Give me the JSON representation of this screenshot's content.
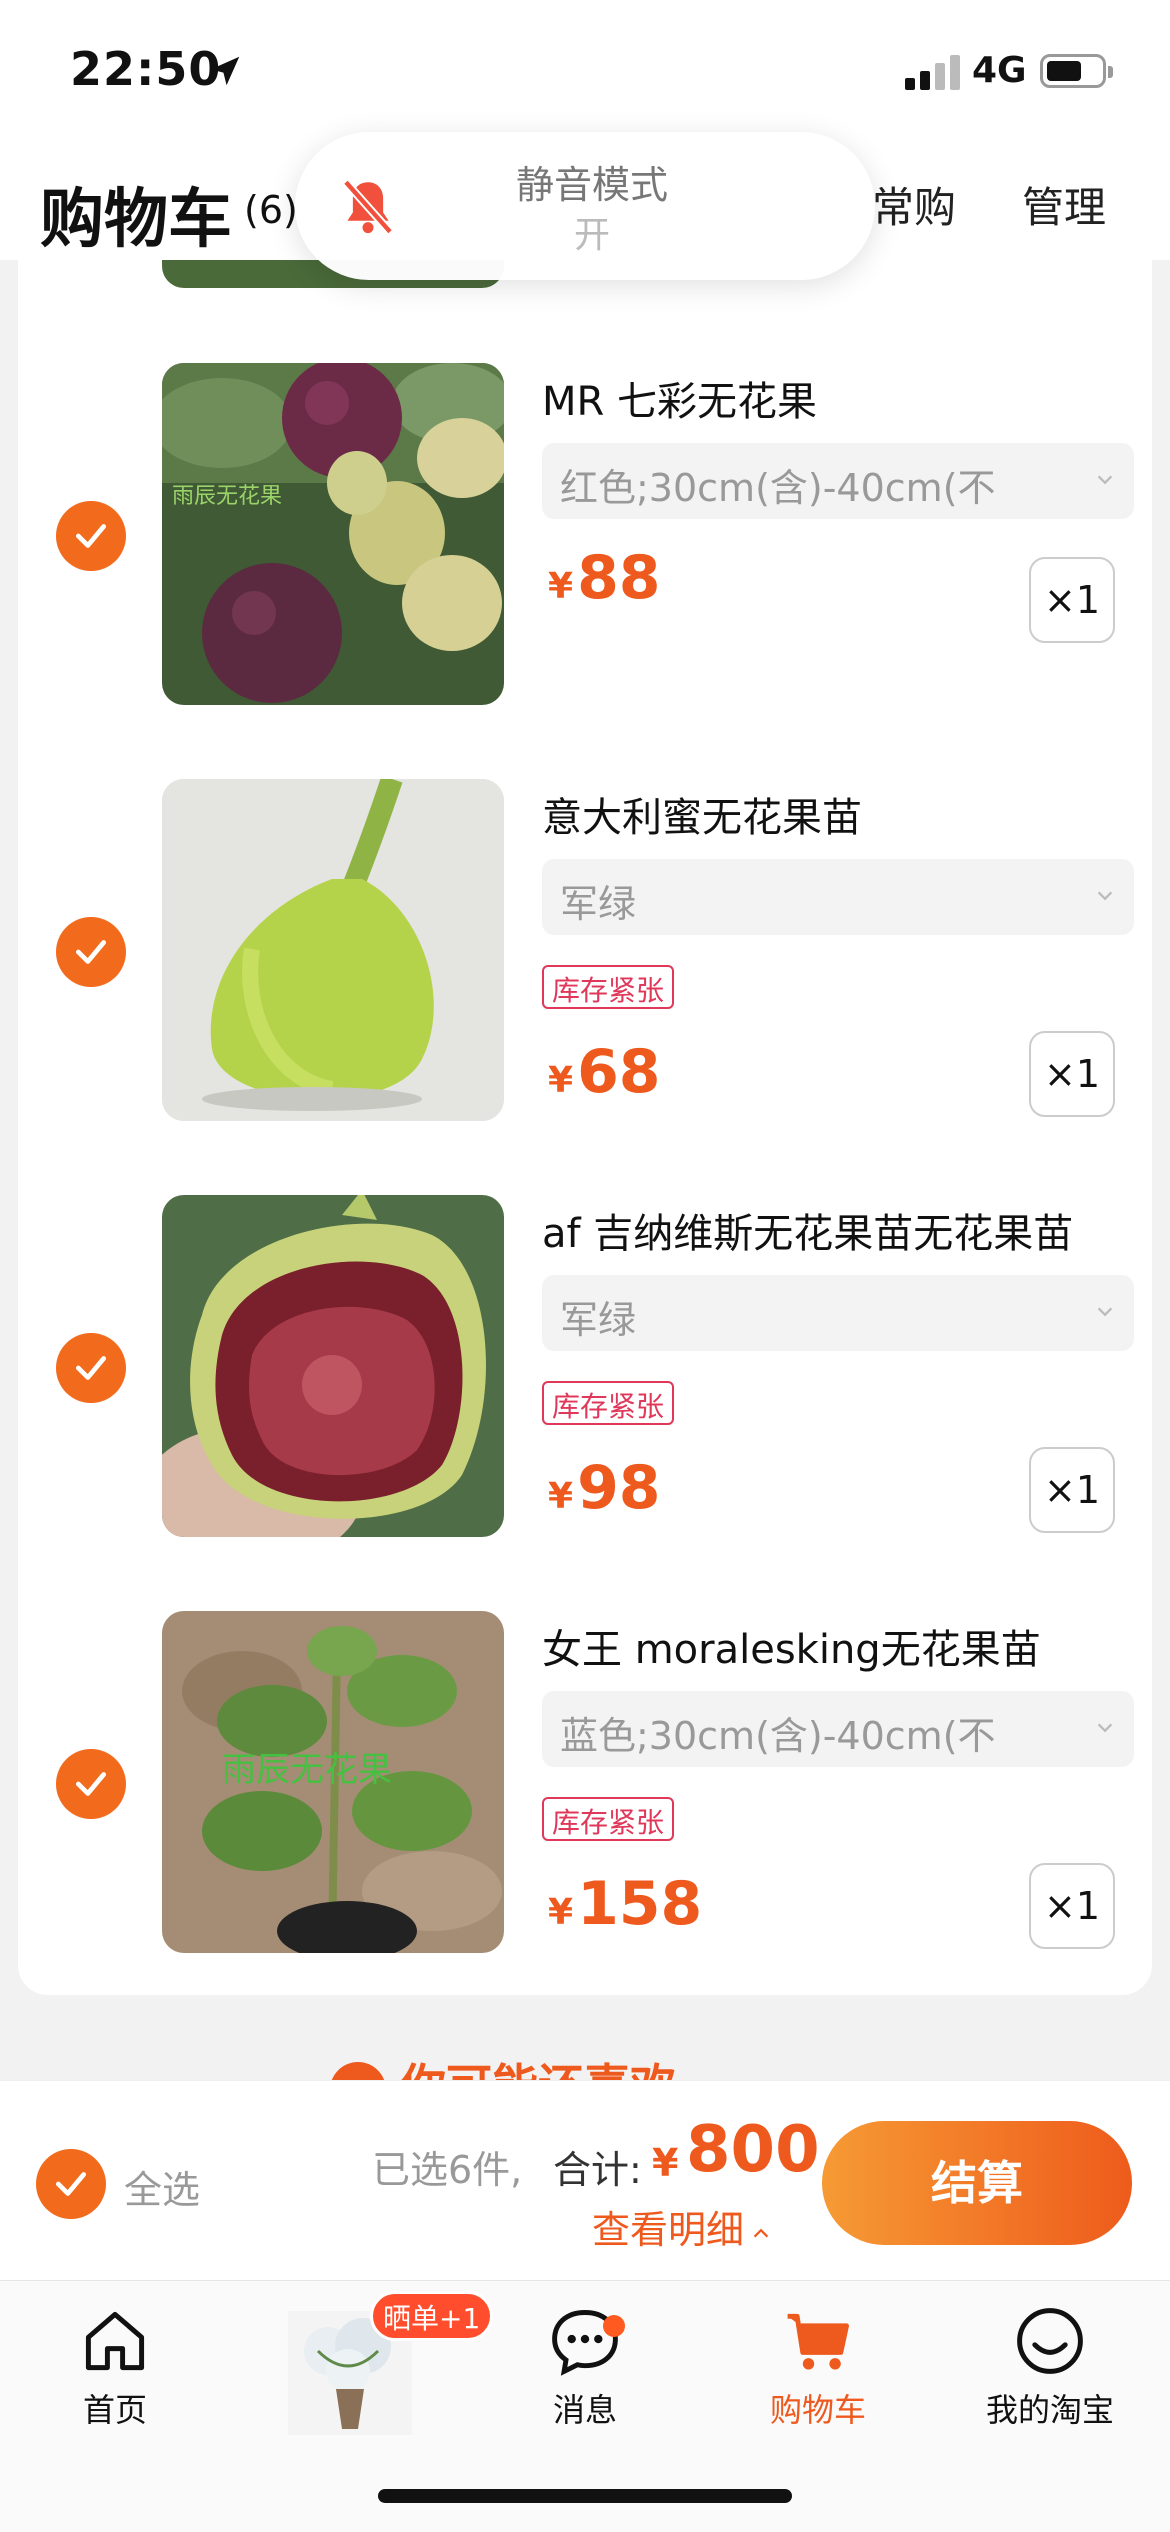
{
  "status_bar": {
    "time": "22:50",
    "network": "4G",
    "battery_level": 0.6
  },
  "header": {
    "title": "购物车",
    "count": "(6)",
    "frequent_label": "常购",
    "manage_label": "管理"
  },
  "toast": {
    "title": "静音模式",
    "subtitle": "开"
  },
  "items": [
    {
      "title": "MR 七彩无花果",
      "sku": "红色;30cm(含)-40cm(不",
      "stock_tag": "",
      "price_symbol": "¥",
      "price": "88",
      "qty": "×1",
      "image_icon": "fig-purple-cluster-photo",
      "image_watermark": "雨辰无花果"
    },
    {
      "title": "意大利蜜无花果苗",
      "sku": "军绿",
      "stock_tag": "库存紧张",
      "price_symbol": "¥",
      "price": "68",
      "qty": "×1",
      "image_icon": "green-fig-photo"
    },
    {
      "title": "af 吉纳维斯无花果苗无花果苗",
      "sku": "军绿",
      "stock_tag": "库存紧张",
      "price_symbol": "¥",
      "price": "98",
      "qty": "×1",
      "image_icon": "fig-cut-half-photo"
    },
    {
      "title": "女王 moralesking无花果苗",
      "sku": "蓝色;30cm(含)-40cm(不",
      "stock_tag": "库存紧张",
      "price_symbol": "¥",
      "price": "158",
      "qty": "×1",
      "image_icon": "fig-seedling-photo",
      "image_watermark": "雨辰无花果"
    }
  ],
  "recommend": {
    "title": "你可能还喜欢"
  },
  "checkout": {
    "select_all_label": "全选",
    "selected_info": "已选6件,",
    "total_label": "合计:",
    "total_symbol": "¥",
    "total_value": "800",
    "detail_link": "查看明细",
    "button_label": "结算"
  },
  "tabbar": {
    "items": [
      {
        "label": "首页",
        "icon": "home-icon"
      },
      {
        "label": "",
        "icon": "promo-thumbnail",
        "badge": "晒单+1"
      },
      {
        "label": "消息",
        "icon": "chat-bubble-icon"
      },
      {
        "label": "购物车",
        "icon": "cart-icon",
        "active": true
      },
      {
        "label": "我的淘宝",
        "icon": "smile-face-icon"
      }
    ]
  },
  "colors": {
    "accent": "#ee5a1e",
    "check": "#f26a1b",
    "stock_tag": "#e0385a",
    "background": "#f2f2f2"
  }
}
